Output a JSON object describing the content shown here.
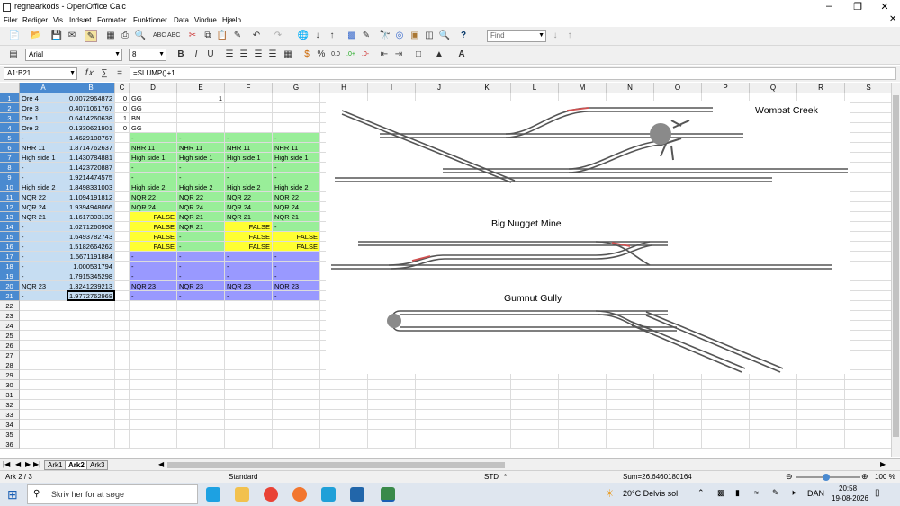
{
  "window": {
    "title": "regnearkods - OpenOffice Calc"
  },
  "menu": [
    "Filer",
    "Rediger",
    "Vis",
    "Indsæt",
    "Formater",
    "Funktioner",
    "Data",
    "Vindue",
    "Hjælp"
  ],
  "toolbar": {
    "find_placeholder": "Find",
    "font_name": "Arial",
    "font_size": "8"
  },
  "formula": {
    "name_box": "A1:B21",
    "content": "=SLUMP()+1"
  },
  "columns": [
    "A",
    "B",
    "C",
    "D",
    "E",
    "F",
    "G",
    "H",
    "I",
    "J",
    "K",
    "L",
    "M",
    "N",
    "O",
    "P",
    "Q",
    "R",
    "S"
  ],
  "rows": [
    {
      "a": "Ore 4",
      "b": "0.0072964872",
      "c": "0",
      "d": "GG",
      "e": "1",
      "f": "",
      "g": ""
    },
    {
      "a": "Ore 3",
      "b": "0.4071061767",
      "c": "0",
      "d": "GG",
      "e": "",
      "f": "",
      "g": ""
    },
    {
      "a": "Ore 1",
      "b": "0.6414260638",
      "c": "1",
      "d": "BN",
      "e": "",
      "f": "",
      "g": ""
    },
    {
      "a": "Ore 2",
      "b": "0.1330621901",
      "c": "0",
      "d": "GG",
      "e": "",
      "f": "",
      "g": ""
    },
    {
      "a": "-",
      "b": "1.4629188767",
      "c": "",
      "d": "-",
      "e": "-",
      "f": "-",
      "g": "-"
    },
    {
      "a": "NHR 11",
      "b": "1.8714762637",
      "c": "",
      "d": "NHR 11",
      "e": "NHR 11",
      "f": "NHR 11",
      "g": "NHR 11"
    },
    {
      "a": "High side 1",
      "b": "1.1430784881",
      "c": "",
      "d": "High side 1",
      "e": "High side 1",
      "f": "High side 1",
      "g": "High side 1"
    },
    {
      "a": "-",
      "b": "1.1423720887",
      "c": "",
      "d": "-",
      "e": "-",
      "f": "-",
      "g": "-"
    },
    {
      "a": "-",
      "b": "1.9214474575",
      "c": "",
      "d": "-",
      "e": "-",
      "f": "-",
      "g": "-"
    },
    {
      "a": "High side 2",
      "b": "1.8498331003",
      "c": "",
      "d": "High side 2",
      "e": "High side 2",
      "f": "High side 2",
      "g": "High side 2"
    },
    {
      "a": "NQR 22",
      "b": "1.1094191812",
      "c": "",
      "d": "NQR 22",
      "e": "NQR 22",
      "f": "NQR 22",
      "g": "NQR 22"
    },
    {
      "a": "NQR 24",
      "b": "1.9394948066",
      "c": "",
      "d": "NQR 24",
      "e": "NQR 24",
      "f": "NQR 24",
      "g": "NQR 24"
    },
    {
      "a": "NQR 21",
      "b": "1.1617303139",
      "c": "",
      "d": "FALSE",
      "e": "NQR 21",
      "f": "NQR 21",
      "g": "NQR 21"
    },
    {
      "a": "-",
      "b": "1.0271260908",
      "c": "",
      "d": "FALSE",
      "e": "NQR 21",
      "f": "FALSE",
      "g": "-"
    },
    {
      "a": "-",
      "b": "1.6493782743",
      "c": "",
      "d": "FALSE",
      "e": "-",
      "f": "FALSE",
      "g": "FALSE"
    },
    {
      "a": "-",
      "b": "1.5182664262",
      "c": "",
      "d": "FALSE",
      "e": "-",
      "f": "FALSE",
      "g": "FALSE"
    },
    {
      "a": "-",
      "b": "1.5671191884",
      "c": "",
      "d": "-",
      "e": "-",
      "f": "-",
      "g": "-"
    },
    {
      "a": "-",
      "b": "1.000531794",
      "c": "",
      "d": "-",
      "e": "-",
      "f": "-",
      "g": "-"
    },
    {
      "a": "-",
      "b": "1.7915345298",
      "c": "",
      "d": "-",
      "e": "-",
      "f": "-",
      "g": "-"
    },
    {
      "a": "NQR 23",
      "b": "1.3241239213",
      "c": "",
      "d": "NQR 23",
      "e": "NQR 23",
      "f": "NQR 23",
      "g": "NQR 23"
    },
    {
      "a": "-",
      "b": "1.9772762968",
      "c": "",
      "d": "-",
      "e": "-",
      "f": "-",
      "g": "-"
    }
  ],
  "row_count": 36,
  "drawing": {
    "titles": [
      "Wombat Creek",
      "Big Nugget Mine",
      "Gumnut Gully"
    ]
  },
  "sheets": [
    "Ark1",
    "Ark2",
    "Ark3"
  ],
  "status": {
    "sheet": "Ark 2 / 3",
    "style": "Standard",
    "mode": "STD",
    "sum": "Sum=26.6460180164",
    "zoom": "100 %"
  },
  "taskbar": {
    "search": "Skriv her for at søge",
    "weather": "20°C  Delvis sol",
    "lang": "DAN",
    "time": "20:58",
    "date": "19-08-2026"
  },
  "colors": {
    "green": "#99ee99",
    "yellow": "#ffff33",
    "purple": "#9999ff",
    "selection": "#c6ddf2",
    "header_sel": "#4a8ad0"
  }
}
